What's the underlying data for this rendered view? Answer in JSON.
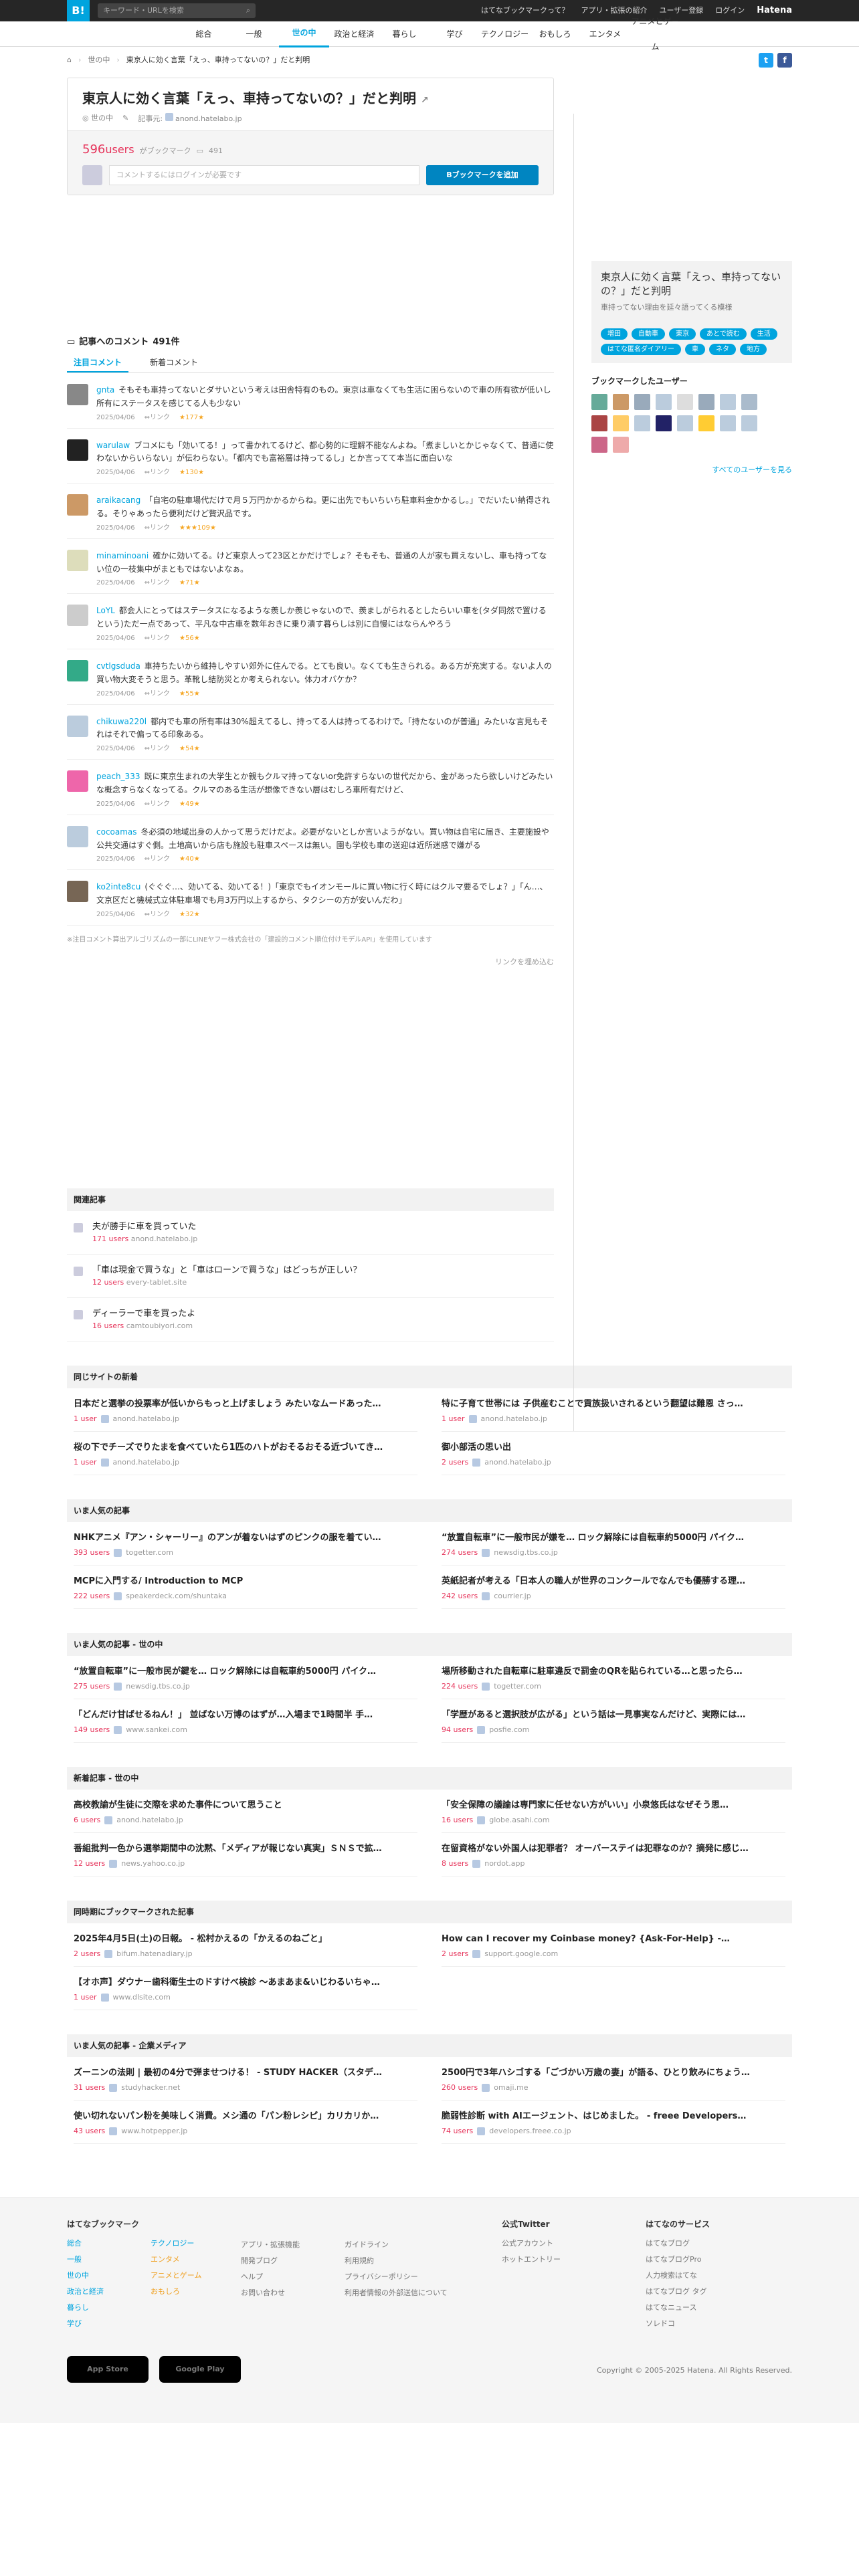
{
  "topbar": {
    "logo": "B!",
    "search_placeholder": "キーワード・URLを検索",
    "links": [
      "はてなブックマークって？",
      "アプリ・拡張の紹介",
      "ユーザー登録",
      "ログイン"
    ],
    "brand": "Hatena"
  },
  "categories": [
    {
      "label": "総合",
      "active": false
    },
    {
      "label": "一般",
      "active": false
    },
    {
      "label": "世の中",
      "active": true
    },
    {
      "label": "政治と経済",
      "active": false
    },
    {
      "label": "暮らし",
      "active": false
    },
    {
      "label": "学び",
      "active": false
    },
    {
      "label": "テクノロジー",
      "active": false
    },
    {
      "label": "おもしろ",
      "active": false
    },
    {
      "label": "エンタメ",
      "active": false
    },
    {
      "label": "アニメとゲーム",
      "active": false
    }
  ],
  "breadcrumb": {
    "category": "世の中",
    "current": "東京人に効く言葉「えっ、車持ってないの？」だと判明"
  },
  "entry": {
    "title": "東京人に効く言葉「えっ、車持ってないの？」だと判明",
    "category": "世の中",
    "domain_label": "記事元:",
    "domain": "anond.hatelabo.jp",
    "users": "596",
    "users_unit": "users",
    "bookmark_label": "がブックマーク",
    "comment_count": "491",
    "comment_placeholder": "コメントするにはログインが必要です",
    "add_button": "Bブックマークを追加"
  },
  "sidebar": {
    "title": "東京人に効く言葉「えっ、車持ってないの？」だと判明",
    "desc": "車持ってない理由を延々語ってくる模様",
    "tags": [
      "増田",
      "自動車",
      "東京",
      "あとで読む",
      "生活",
      "はてな匿名ダイアリー",
      "車",
      "ネタ",
      "地方"
    ],
    "bookmarked_by": "ブックマークしたユーザー",
    "see_all": "すべてのユーザーを見る"
  },
  "comments": {
    "heading": "記事へのコメント",
    "count": "491件",
    "tabs": [
      "注目コメント",
      "新着コメント"
    ],
    "items": [
      {
        "user": "gnta",
        "text": "そもそも車持ってないとダサいという考えは田舎特有のもの。東京は車なくても生活に困らないので車の所有欲が低いし所有にステータスを感じてる人も少ない",
        "date": "2025/04/06",
        "stars": "★177★"
      },
      {
        "user": "warulaw",
        "text": "ブコメにも「効いてる！」って書かれてるけど、都心勢的に理解不能なんよね。「煮ましいとかじゃなくて、普通に使わないからいらない」が伝わらない。「都内でも富裕層は持ってるし」とか言ってて本当に面白いな",
        "date": "2025/04/06",
        "stars": "★130★"
      },
      {
        "user": "araikacang",
        "text": "「自宅の駐車場代だけで月５万円かかるからね。更に出先でもいちいち駐車料金かかるし。」でだいたい納得される。そりゃあったら便利だけど贅沢品です。",
        "date": "2025/04/06",
        "stars": "★★★109★"
      },
      {
        "user": "minaminoani",
        "text": "確かに効いてる。けど東京人って23区とかだけでしょ？そもそも、普通の人が家も買えないし、車も持ってない位の一枝集中がまともではないよなぁ。",
        "date": "2025/04/06",
        "stars": "★71★"
      },
      {
        "user": "LoYL",
        "text": "都会人にとってはステータスになるような羨しか羨じゃないので、羨ましがられるとしたらいい車を(タダ同然で置けるという)ただ一点であって、平凡な中古車を数年おきに乗り潰す暮らしは別に自慢にはならんやろう",
        "date": "2025/04/06",
        "stars": "★56★"
      },
      {
        "user": "cvtlgsduda",
        "text": "車持ちたいから維持しやすい郊外に住んでる。とても良い。なくても生きられる。ある方が充実する。ないよ人の買い物大変そうと思う。革靴し結防災とか考えられない。体力オバケか？",
        "date": "2025/04/06",
        "stars": "★55★"
      },
      {
        "user": "chikuwa220l",
        "text": "都内でも車の所有率は30%超えてるし、持ってる人は持ってるわけで。「持たないのが普通」みたいな言見もそれはそれで偏ってる印象ある。",
        "date": "2025/04/06",
        "stars": "★54★"
      },
      {
        "user": "peach_333",
        "text": "既に東京生まれの大学生とか親もクルマ持ってないor免許すらないの世代だから、金があったら欲しいけどみたいな概念すらなくなってる。クルマのある生活が想像できない層はむしろ車所有だけど、",
        "date": "2025/04/06",
        "stars": "★49★"
      },
      {
        "user": "cocoamas",
        "text": "冬必須の地域出身の人かって思うだけだよ。必要がないとしか言いようがない。買い物は自宅に届き、主要施設や公共交通はすぐ側。土地高いから店も施設も駐車スペースは無い。園も学校も車の送迎は近所迷惑で嫌がる",
        "date": "2025/04/06",
        "stars": "★40★"
      },
      {
        "user": "ko2inte8cu",
        "text": "(ぐぐぐ…、効いてる、効いてる！)「東京でもイオンモールに買い物に行く時にはクルマ要るでしょ？」「ん…、文京区だと機械式立体駐車場でも月3万円以上するから、タクシーの方が安いんだわ」",
        "date": "2025/04/06",
        "stars": "★32★"
      }
    ],
    "note": "※注目コメント算出アルゴリズムの一部にLINEヤフー株式会社の「建設的コメント順位付けモデルAPI」を使用しています",
    "more": "リンクを埋め込む"
  },
  "related": {
    "heading": "関連記事",
    "items": [
      {
        "title": "夫が勝手に車を買っていた",
        "users": "171 users",
        "domain": "anond.hatelabo.jp"
      },
      {
        "title": "「車は現金で買うな」と「車はローンで買うな」はどっちが正しい？",
        "users": "12 users",
        "domain": "every-tablet.site"
      },
      {
        "title": "ディーラーで車を買ったよ",
        "users": "16 users",
        "domain": "camtoubiyori.com"
      }
    ]
  },
  "sections": [
    {
      "heading": "同じサイトの新着",
      "items": [
        {
          "title": "日本だと選挙の投票率が低いからもっと上げましょう みたいなムードあった…",
          "users": "1 user",
          "domain": "anond.hatelabo.jp"
        },
        {
          "title": "特に子育て世帯には 子供産むことで貢族扱いされるという翻望は難恩 さっ…",
          "users": "1 user",
          "domain": "anond.hatelabo.jp"
        },
        {
          "title": "桜の下でチーズでりたまを食べていたら1匹のハトがおそるおそる近づいてき…",
          "users": "1 user",
          "domain": "anond.hatelabo.jp"
        },
        {
          "title": "御小部活の思い出",
          "users": "2 users",
          "domain": "anond.hatelabo.jp"
        }
      ]
    },
    {
      "heading": "いま人気の記事",
      "items": [
        {
          "title": "NHKアニメ『アン・シャーリー』のアンが着ないはずのピンクの服を着てい…",
          "users": "393 users",
          "domain": "togetter.com"
        },
        {
          "title": "“放置自転車”に一般市民が嫌を… ロック解除には自転車約5000円 パイク…",
          "users": "274 users",
          "domain": "newsdig.tbs.co.jp"
        },
        {
          "title": "MCPに入門する/ Introduction to MCP",
          "users": "222 users",
          "domain": "speakerdeck.com/shuntaka"
        },
        {
          "title": "英紙記者が考える「日本人の職人が世界のコンクールでなんでも優勝する理…",
          "users": "242 users",
          "domain": "courrier.jp"
        }
      ]
    },
    {
      "heading": "いま人気の記事 - 世の中",
      "items": [
        {
          "title": "“放置自転車”に一般市民が鍵を… ロック解除には自転車約5000円 パイク…",
          "users": "275 users",
          "domain": "newsdig.tbs.co.jp"
        },
        {
          "title": "場所移動された自転車に駐車違反で罰金のQRを貼られている…と思ったら…",
          "users": "224 users",
          "domain": "togetter.com"
        },
        {
          "title": "「どんだけ甘ばせるねん！」 並ばない万博のはずが…入場まで1時間半 手…",
          "users": "149 users",
          "domain": "www.sankei.com"
        },
        {
          "title": "「学歴があると選択肢が広がる」という話は一見事実なんだけど、実際には…",
          "users": "94 users",
          "domain": "posfie.com"
        }
      ]
    },
    {
      "heading": "新着記事 - 世の中",
      "items": [
        {
          "title": "高校教諭が生徒に交際を求めた事件について思うこと",
          "users": "6 users",
          "domain": "anond.hatelabo.jp"
        },
        {
          "title": "「安全保障の議論は専門家に任せない方がいい」小泉悠氏はなぜそう思…",
          "users": "16 users",
          "domain": "globe.asahi.com"
        },
        {
          "title": "番組批判一色から選挙期間中の沈黙、「メディアが報じない真実」ＳＮＳで拡…",
          "users": "12 users",
          "domain": "news.yahoo.co.jp"
        },
        {
          "title": "在留資格がない外国人は犯罪者？ オーバーステイは犯罪なのか？摘発に感じ…",
          "users": "8 users",
          "domain": "nordot.app"
        }
      ]
    },
    {
      "heading": "同時期にブックマークされた記事",
      "items": [
        {
          "title": "2025年4月5日(土)の日報。 - 松村かえるの「かえるのねごと」",
          "users": "2 users",
          "domain": "bifum.hatenadiary.jp"
        },
        {
          "title": "How can I recover my Coinbase money? {Ask-For-Help} -…",
          "users": "2 users",
          "domain": "support.google.com"
        },
        {
          "title": "【オホ声】ダウナー歯科衛生士のドすけべ検診 〜あまあま&いじわるいちゃ…",
          "users": "1 user",
          "domain": "www.dlsite.com"
        }
      ]
    },
    {
      "heading": "いま人気の記事 - 企業メディア",
      "items": [
        {
          "title": "ズーニンの法則 | 最初の4分で弾ませつける！ - STUDY HACKER（スタデ…",
          "users": "31 users",
          "domain": "studyhacker.net"
        },
        {
          "title": "2500円で3年ハシゴする「ごづかい万歳の妻」が語る、ひとり飲みにちょう…",
          "users": "260 users",
          "domain": "omaji.me"
        },
        {
          "title": "使い切れないパン粉を美味しく消費。メシ通の「パン粉レシピ」カリカリか…",
          "users": "43 users",
          "domain": "www.hotpepper.jp"
        },
        {
          "title": "脆弱性診断 with AIエージェント、はじめました。 - freee Developers…",
          "users": "74 users",
          "domain": "developers.freee.co.jp"
        }
      ]
    }
  ],
  "footer": {
    "col1_title": "はてなブックマーク",
    "col1a": [
      "総合",
      "一般",
      "世の中",
      "政治と経済",
      "暮らし",
      "学び"
    ],
    "col1b": [
      "テクノロジー",
      "エンタメ",
      "アニメとゲーム",
      "おもしろ"
    ],
    "col2": [
      "アプリ・拡張機能",
      "開発ブログ",
      "ヘルプ",
      "お問い合わせ"
    ],
    "col3": [
      "ガイドライン",
      "利用規約",
      "プライバシーポリシー",
      "利用者情報の外部送信について"
    ],
    "col4_title": "公式Twitter",
    "col4": [
      "公式アカウント",
      "ホットエントリー"
    ],
    "col5_title": "はてなのサービス",
    "col5": [
      "はてなブログ",
      "はてなブログPro",
      "人力検索はてな",
      "はてなブログ タグ",
      "はてなニュース",
      "ソレドコ"
    ],
    "appstore": "App Store",
    "googleplay": "Google Play",
    "copyright": "Copyright © 2005-2025 Hatena. All Rights Reserved."
  }
}
